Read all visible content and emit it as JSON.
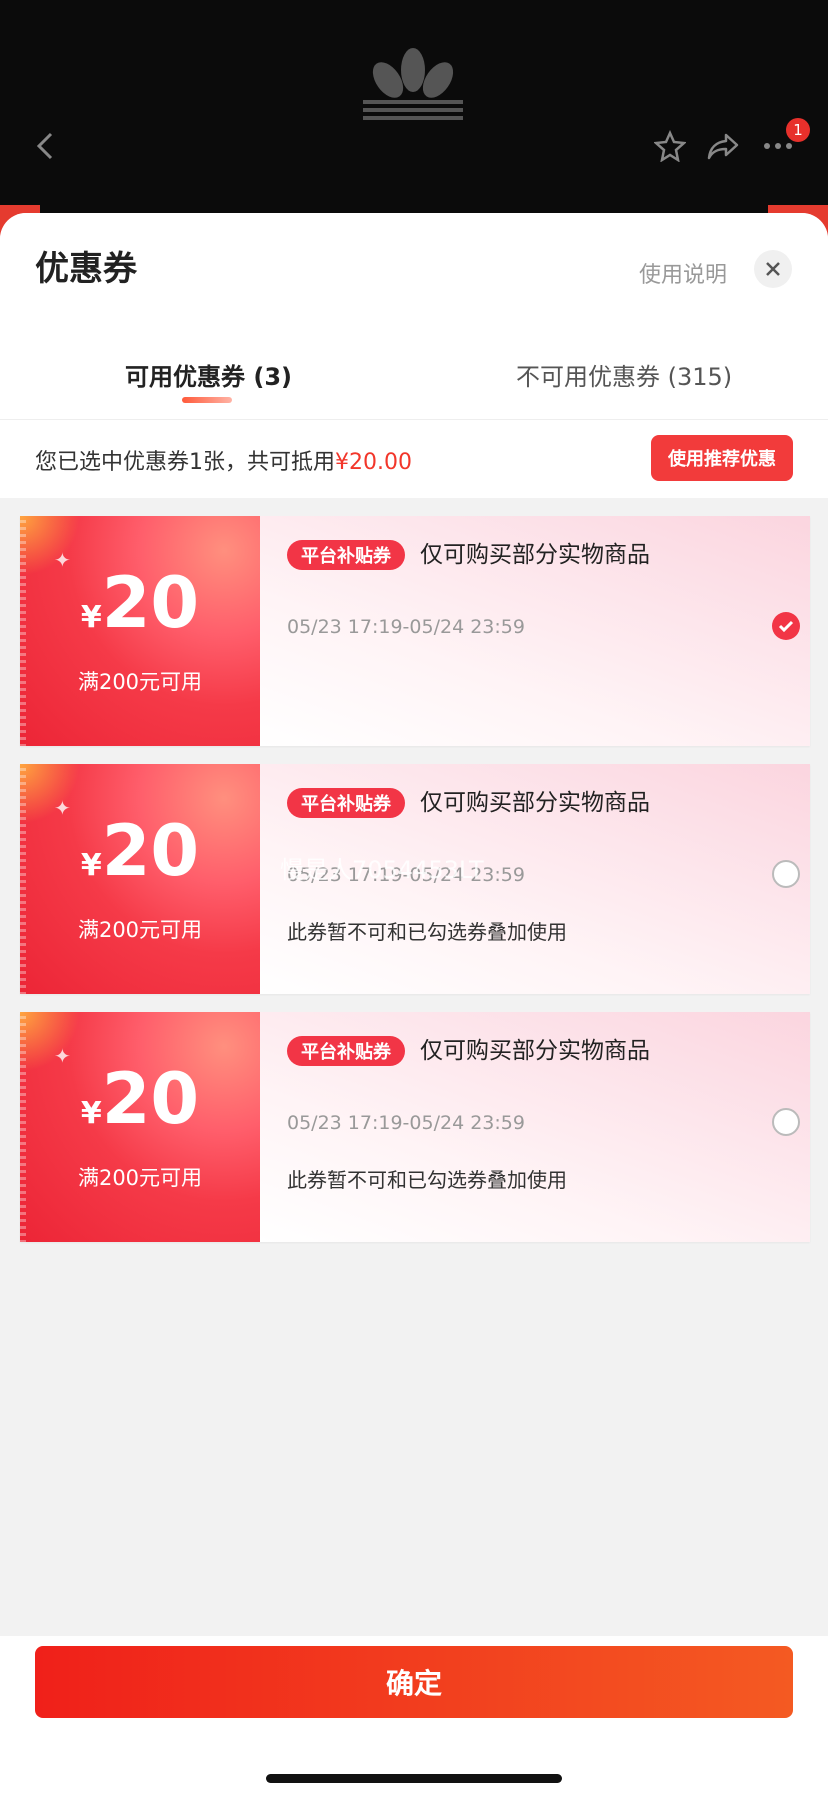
{
  "nav": {
    "notification_count": "1"
  },
  "sheet": {
    "title": "优惠券",
    "help_label": "使用说明",
    "tabs": [
      {
        "label": "可用优惠券 (3)",
        "active": true
      },
      {
        "label": "不可用优惠券 (315)",
        "active": false
      }
    ],
    "summary": {
      "text": "您已选中优惠券1张，共可抵用",
      "amount": "¥20.00"
    },
    "recommend_label": "使用推荐优惠"
  },
  "coupons": [
    {
      "yen": "¥",
      "value": "20",
      "condition": "满200元可用",
      "tag": "平台补贴券",
      "description": "仅可购买部分实物商品",
      "time": "05/23 17:19-05/24 23:59",
      "note": "",
      "selected": true
    },
    {
      "yen": "¥",
      "value": "20",
      "condition": "满200元可用",
      "tag": "平台补贴券",
      "description": "仅可购买部分实物商品",
      "time": "05/23 17:19-05/24 23:59",
      "note": "此券暂不可和已勾选券叠加使用",
      "selected": false
    },
    {
      "yen": "¥",
      "value": "20",
      "condition": "满200元可用",
      "tag": "平台补贴券",
      "description": "仅可购买部分实物商品",
      "time": "05/23 17:19-05/24 23:59",
      "note": "此券暂不可和已勾选券叠加使用",
      "selected": false
    }
  ],
  "watermark": "慢是人7054453LT",
  "footer": {
    "confirm_label": "确定"
  },
  "colors": {
    "accent": "#f23546",
    "confirm_start": "#f0201a",
    "confirm_end": "#f45a22"
  }
}
